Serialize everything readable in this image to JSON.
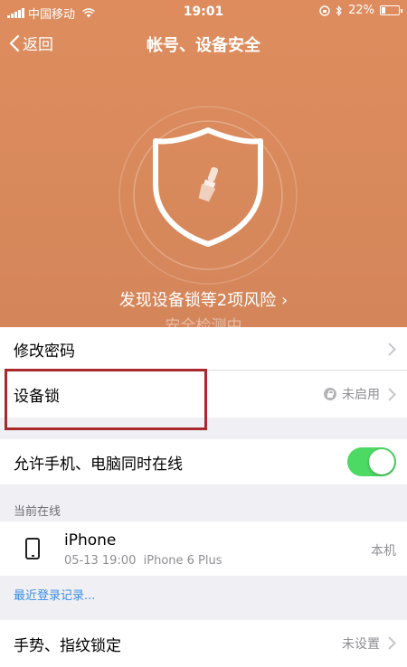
{
  "status_bar": {
    "carrier": "中国移动",
    "time": "19:01",
    "battery": "22%"
  },
  "nav": {
    "back_label": "返回",
    "title": "帐号、设备安全"
  },
  "hero": {
    "risk_text": "发现设备锁等2项风险",
    "checking_text": "安全检测中"
  },
  "settings": {
    "change_password": "修改密码",
    "device_lock": {
      "label": "设备锁",
      "status": "未启用"
    },
    "simultaneous_online": {
      "label": "允许手机、电脑同时在线",
      "enabled": true
    }
  },
  "online_devices": {
    "section_title": "当前在线",
    "devices": [
      {
        "name": "iPhone",
        "time": "05-13 19:00",
        "model": "iPhone 6 Plus",
        "tag": "本机"
      }
    ],
    "recent_login_link": "最近登录记录..."
  },
  "gesture_lock": {
    "label": "手势、指纹锁定",
    "status": "未设置"
  },
  "colors": {
    "hero_bg": "#d98a5c",
    "toggle_on": "#4cd964",
    "link": "#3a8ee6",
    "highlight": "#a8282c"
  }
}
